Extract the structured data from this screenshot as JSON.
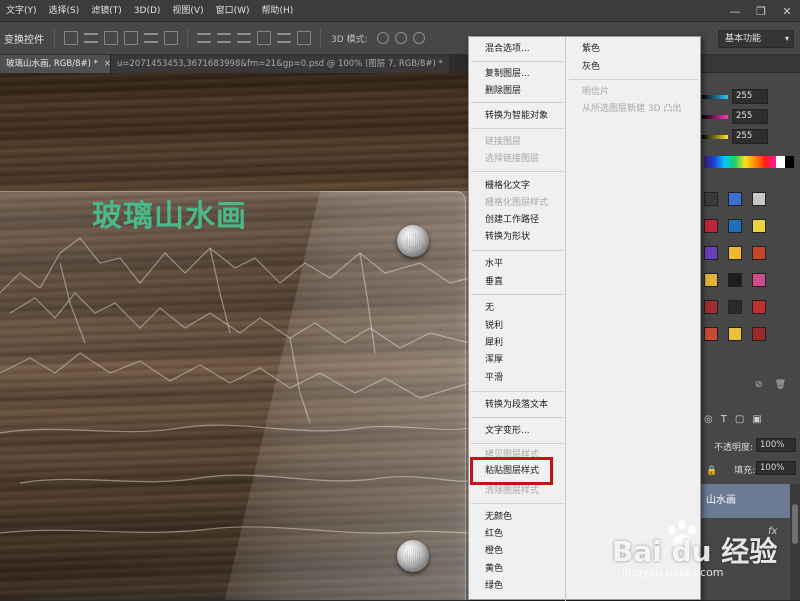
{
  "menubar": {
    "items": [
      "文字(Y)",
      "选择(S)",
      "滤镜(T)",
      "3D(D)",
      "视图(V)",
      "窗口(W)",
      "帮助(H)"
    ],
    "window_controls": [
      "—",
      "❐",
      "✕"
    ]
  },
  "options_bar": {
    "label": "变换控件",
    "mode_3d_label": "3D 模式:",
    "workspace": "基本功能"
  },
  "tabs": [
    {
      "label": "玻璃山水画, RGB/8#) *",
      "close": "×",
      "active": true
    },
    {
      "label": "u=2071453453,3671683998&fm=21&gp=0.psd @ 100% (图层 7, RGB/8#) *",
      "close": "",
      "active": false
    }
  ],
  "canvas": {
    "title": "玻璃山水画"
  },
  "right_panel": {
    "slider_values": [
      "255",
      "255",
      "255"
    ],
    "slider_colors": [
      "#33c2ff",
      "#ff33c8",
      "#ffe833"
    ],
    "swatch_colors": [
      "#3a3a3a",
      "#3d6fd1",
      "#c8c8c8",
      "#c0243a",
      "#1d6fbb",
      "#e8d43a",
      "#6a3fbb",
      "#f0b830",
      "#c8452a",
      "#e0b43a",
      "#1c1c1c",
      "#d04a8a",
      "#a03030",
      "#2a2a2a",
      "#c03030",
      "#c84b32",
      "#e8c23a",
      "#9a2a2a"
    ],
    "opacity_label": "不透明度:",
    "opacity_value": "100%",
    "fill_label": "填充:",
    "fill_value": "100%",
    "selected_layer": "山水画",
    "fx_label": "fx"
  },
  "context_menu": {
    "col1": [
      {
        "label": "混合选项...",
        "enabled": true
      },
      {
        "label": "复制图层...",
        "enabled": true
      },
      {
        "label": "删除图层",
        "enabled": true
      },
      {
        "label": "转换为智能对象",
        "enabled": true
      },
      {
        "label": "链接图层",
        "enabled": false
      },
      {
        "label": "选择链接图层",
        "enabled": false
      },
      {
        "label": "栅格化文字",
        "enabled": true
      },
      {
        "label": "栅格化图层样式",
        "enabled": false
      },
      {
        "label": "创建工作路径",
        "enabled": true
      },
      {
        "label": "转换为形状",
        "enabled": true
      },
      {
        "label": "水平",
        "enabled": true
      },
      {
        "label": "垂直",
        "enabled": true
      },
      {
        "label": "无",
        "enabled": true
      },
      {
        "label": "锐利",
        "enabled": true
      },
      {
        "label": "犀利",
        "enabled": true
      },
      {
        "label": "浑厚",
        "enabled": true
      },
      {
        "label": "平滑",
        "enabled": true
      },
      {
        "label": "转换为段落文本",
        "enabled": true
      },
      {
        "label": "文字变形...",
        "enabled": true
      },
      {
        "label": "拷贝图层样式",
        "enabled": false
      },
      {
        "label": "粘贴图层样式",
        "enabled": true
      },
      {
        "label": "清除图层样式",
        "enabled": false
      },
      {
        "label": "无颜色",
        "enabled": true
      },
      {
        "label": "红色",
        "enabled": true
      },
      {
        "label": "橙色",
        "enabled": true
      },
      {
        "label": "黄色",
        "enabled": true
      },
      {
        "label": "绿色",
        "enabled": true
      }
    ],
    "col2": [
      {
        "label": "紫色",
        "enabled": true
      },
      {
        "label": "灰色",
        "enabled": true
      },
      {
        "label": "明信片",
        "enabled": false
      },
      {
        "label": "从所选图层新建 3D 凸出",
        "enabled": false
      }
    ],
    "highlighted_item": "粘贴图层样式",
    "highlight_color": "#c0141a"
  },
  "watermark": {
    "brand": "Bai du 经验",
    "url": "jingyan.baidu.com"
  }
}
